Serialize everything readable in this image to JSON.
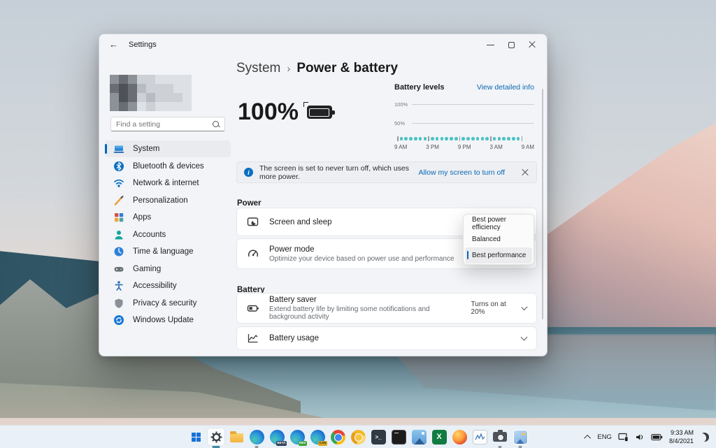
{
  "glyphs": {
    "back_arrow": "←"
  },
  "window": {
    "title": "Settings",
    "breadcrumb": {
      "parent": "System",
      "separator": "›",
      "current": "Power & battery"
    }
  },
  "sidebar": {
    "search_placeholder": "Find a setting",
    "selected": "System",
    "items": [
      {
        "label": "System"
      },
      {
        "label": "Bluetooth & devices"
      },
      {
        "label": "Network & internet"
      },
      {
        "label": "Personalization"
      },
      {
        "label": "Apps"
      },
      {
        "label": "Accounts"
      },
      {
        "label": "Time & language"
      },
      {
        "label": "Gaming"
      },
      {
        "label": "Accessibility"
      },
      {
        "label": "Privacy & security"
      },
      {
        "label": "Windows Update"
      }
    ]
  },
  "avatar_mosaic": {
    "cols": 9,
    "rows": 4,
    "shades": [
      "#4e5156",
      "#6a6e74",
      "#8d9198",
      "#b8bcc2",
      "#cdd1d6",
      "#dde0e4"
    ],
    "pattern": [
      2,
      1,
      2,
      4,
      4,
      5,
      5,
      5,
      5,
      1,
      0,
      1,
      3,
      4,
      4,
      4,
      5,
      5,
      2,
      0,
      1,
      4,
      3,
      4,
      4,
      4,
      5,
      2,
      1,
      2,
      5,
      4,
      5,
      5,
      5,
      5
    ]
  },
  "overview": {
    "battery_percent": "100%"
  },
  "battery_chart": {
    "type": "scatter",
    "title": "Battery levels",
    "link": "View detailed info",
    "y_ticks": [
      "100%",
      "50%"
    ],
    "x_ticks": [
      "9 AM",
      "3 PM",
      "9 PM",
      "3 AM",
      "9 AM"
    ],
    "segments": 4,
    "dots_per_segment": 6,
    "dot_color": "#4bc2c5"
  },
  "banner": {
    "text": "The screen is set to never turn off, which uses more power.",
    "action": "Allow my screen to turn off"
  },
  "power_section": {
    "label": "Power",
    "screen_sleep": {
      "title": "Screen and sleep"
    },
    "power_mode": {
      "title": "Power mode",
      "subtitle": "Optimize your device based on power use and performance"
    }
  },
  "power_mode_dropdown": {
    "items": [
      {
        "label": "Best power efficiency",
        "selected": false
      },
      {
        "label": "Balanced",
        "selected": false
      },
      {
        "label": "Best performance",
        "selected": true
      }
    ]
  },
  "battery_section": {
    "label": "Battery",
    "battery_saver": {
      "title": "Battery saver",
      "subtitle": "Extend battery life by limiting some notifications and background activity",
      "value": "Turns on at 20%"
    },
    "battery_usage": {
      "title": "Battery usage"
    }
  },
  "taskbar": {
    "terminal_glyph": ">_",
    "excel_letter": "X",
    "icons": [
      {
        "name": "start"
      },
      {
        "name": "settings",
        "running": true,
        "active": true
      },
      {
        "name": "file-explorer"
      },
      {
        "name": "edge",
        "running": true
      },
      {
        "name": "edge-beta",
        "badge": "BETA"
      },
      {
        "name": "edge-dev",
        "badge": "DEV"
      },
      {
        "name": "edge-canary",
        "badge": "CAN"
      },
      {
        "name": "chrome"
      },
      {
        "name": "chrome-canary"
      },
      {
        "name": "terminal"
      },
      {
        "name": "command-prompt"
      },
      {
        "name": "photos"
      },
      {
        "name": "excel"
      },
      {
        "name": "firefox"
      },
      {
        "name": "performance-monitor"
      },
      {
        "name": "camera",
        "running": true
      },
      {
        "name": "movies-tv",
        "running": true
      }
    ],
    "tray": {
      "language": "ENG",
      "time": "9:33 AM",
      "date": "8/4/2021"
    }
  },
  "colors": {
    "accent": "#0067c0",
    "link": "#0b67b2",
    "chart_dot": "#4bc2c5",
    "selected_item_bg": "#e9ebee"
  }
}
